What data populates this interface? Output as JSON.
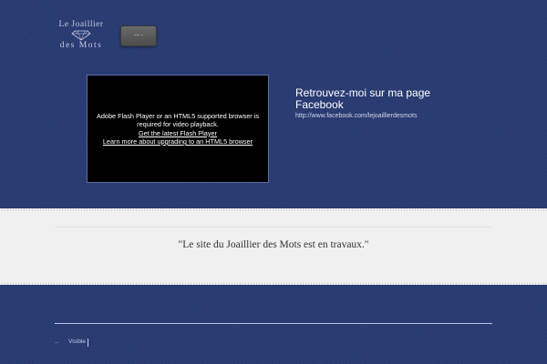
{
  "logo": {
    "line1": "Le Joaillier",
    "line2": "des Mots"
  },
  "nav": {
    "button_label": "--- -"
  },
  "video": {
    "message": "Adobe Flash Player or an HTML5 supported browser is required for video playback.",
    "link1": "Get the latest Flash Player",
    "link2": "Learn more about upgrading to an HTML5 browser"
  },
  "facebook": {
    "title": "Retrouvez-moi sur ma page Facebook",
    "url": "http://www.facebook.com/lejoaillierdesmots"
  },
  "content": {
    "quote": "\"Le site du Joaillier des Mots est en travaux.\""
  },
  "footer": {
    "dots": "..",
    "label": "Visible"
  },
  "colors": {
    "background": "#293b73",
    "band": "#f0f0f0",
    "video_bg": "#000000",
    "footer_rule": "#b8c2e6"
  }
}
